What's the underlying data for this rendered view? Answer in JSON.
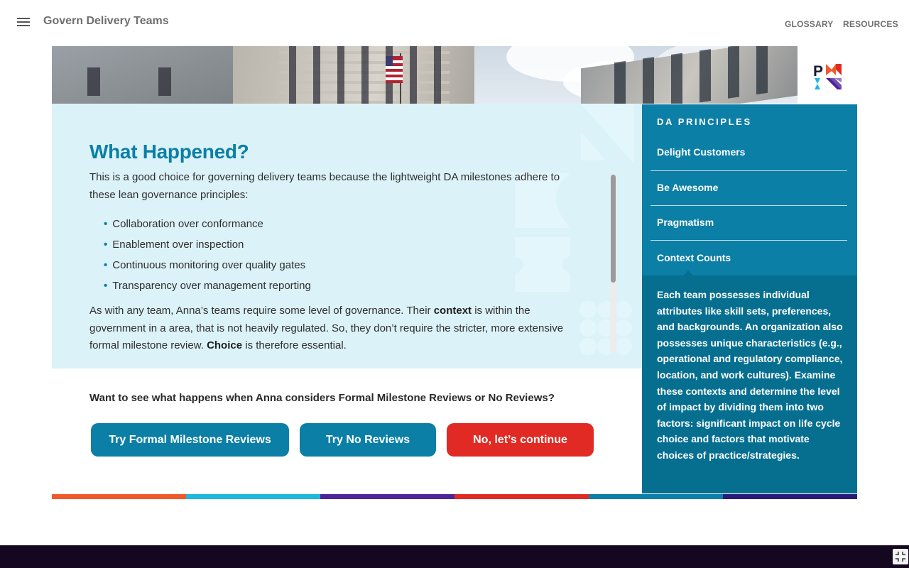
{
  "header": {
    "title": "Govern Delivery Teams",
    "nav": [
      "GLOSSARY",
      "RESOURCES"
    ]
  },
  "icons": {
    "menu": "hamburger-menu-icon",
    "logo": "pmi-logo",
    "fullscreen": "exit-fullscreen-icon"
  },
  "main": {
    "heading": "What Happened?",
    "intro": "This is a good choice for governing delivery teams because the lightweight DA milestones adhere to these lean governance principles:",
    "bullets": [
      "Collaboration over conformance",
      "Enablement over inspection",
      "Continuous monitoring over quality gates",
      "Transparency over management reporting"
    ],
    "para2": {
      "part1": " As with any team, Anna’s teams require some level of governance. Their ",
      "bold1": "context",
      "part2": " is within the government in a area, that is not heavily regulated. So, they don’t require the stricter, more extensive formal milestone review. ",
      "bold2": "Choice",
      "part3": " is therefore essential."
    },
    "question": "Want to see what happens when Anna considers Formal Milestone Reviews or No Reviews?",
    "buttons": {
      "formal": "Try Formal Milestone Reviews",
      "none": "Try No Reviews",
      "continue": "No, let’s continue"
    }
  },
  "sidebar": {
    "heading": "DA PRINCIPLES",
    "items": [
      "Delight Customers",
      "Be Awesome",
      "Pragmatism",
      "Context Counts"
    ],
    "active": "Context Counts",
    "description": "Each team possesses individual attributes like skill sets, preferences, and backgrounds. An organization also possesses unique characteristics (e.g., operational and regulatory compliance, location, and work cultures). Examine these contexts and determine the level of impact by dividing them into two factors: significant impact on life cycle choice and factors that motivate choices of practice/strategies."
  },
  "colors": {
    "accent_teal": "#0b7fa6",
    "side_desc": "#066f90",
    "content_bg": "#dbf2f8",
    "continue_red": "#e12a23",
    "footer": "#15071f",
    "colorbar": [
      "#f0592a",
      "#1eb8dc",
      "#4f239a",
      "#e12a23",
      "#0b7fa6",
      "#2a1b7a"
    ]
  }
}
